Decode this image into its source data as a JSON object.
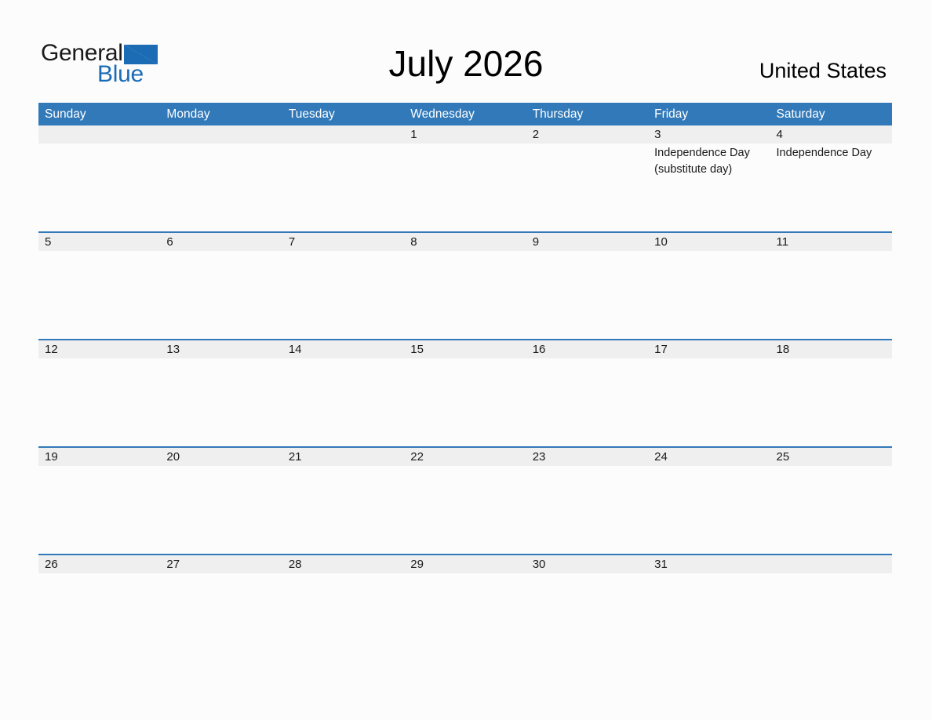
{
  "header": {
    "logo": {
      "line1": "General",
      "line2": "Blue",
      "triangle_icon": "blue-triangle-icon",
      "line1_color": "#1A1A1A",
      "line2_color": "#1B6CB5",
      "triangle_color": "#1B6CB5"
    },
    "month_title": "July 2026",
    "country": "United States"
  },
  "calendar": {
    "accent_color": "#3179B9",
    "header_text_color": "#FFFFFF",
    "date_band_color": "#EFEFEF",
    "cell_background": "#FCFCFC",
    "weekdays": [
      "Sunday",
      "Monday",
      "Tuesday",
      "Wednesday",
      "Thursday",
      "Friday",
      "Saturday"
    ],
    "weeks": [
      {
        "days": [
          {
            "date": "",
            "events": []
          },
          {
            "date": "",
            "events": []
          },
          {
            "date": "",
            "events": []
          },
          {
            "date": "1",
            "events": []
          },
          {
            "date": "2",
            "events": []
          },
          {
            "date": "3",
            "events": [
              "Independence Day (substitute day)"
            ]
          },
          {
            "date": "4",
            "events": [
              "Independence Day"
            ]
          }
        ]
      },
      {
        "days": [
          {
            "date": "5",
            "events": []
          },
          {
            "date": "6",
            "events": []
          },
          {
            "date": "7",
            "events": []
          },
          {
            "date": "8",
            "events": []
          },
          {
            "date": "9",
            "events": []
          },
          {
            "date": "10",
            "events": []
          },
          {
            "date": "11",
            "events": []
          }
        ]
      },
      {
        "days": [
          {
            "date": "12",
            "events": []
          },
          {
            "date": "13",
            "events": []
          },
          {
            "date": "14",
            "events": []
          },
          {
            "date": "15",
            "events": []
          },
          {
            "date": "16",
            "events": []
          },
          {
            "date": "17",
            "events": []
          },
          {
            "date": "18",
            "events": []
          }
        ]
      },
      {
        "days": [
          {
            "date": "19",
            "events": []
          },
          {
            "date": "20",
            "events": []
          },
          {
            "date": "21",
            "events": []
          },
          {
            "date": "22",
            "events": []
          },
          {
            "date": "23",
            "events": []
          },
          {
            "date": "24",
            "events": []
          },
          {
            "date": "25",
            "events": []
          }
        ]
      },
      {
        "days": [
          {
            "date": "26",
            "events": []
          },
          {
            "date": "27",
            "events": []
          },
          {
            "date": "28",
            "events": []
          },
          {
            "date": "29",
            "events": []
          },
          {
            "date": "30",
            "events": []
          },
          {
            "date": "31",
            "events": []
          },
          {
            "date": "",
            "events": []
          }
        ]
      }
    ]
  }
}
